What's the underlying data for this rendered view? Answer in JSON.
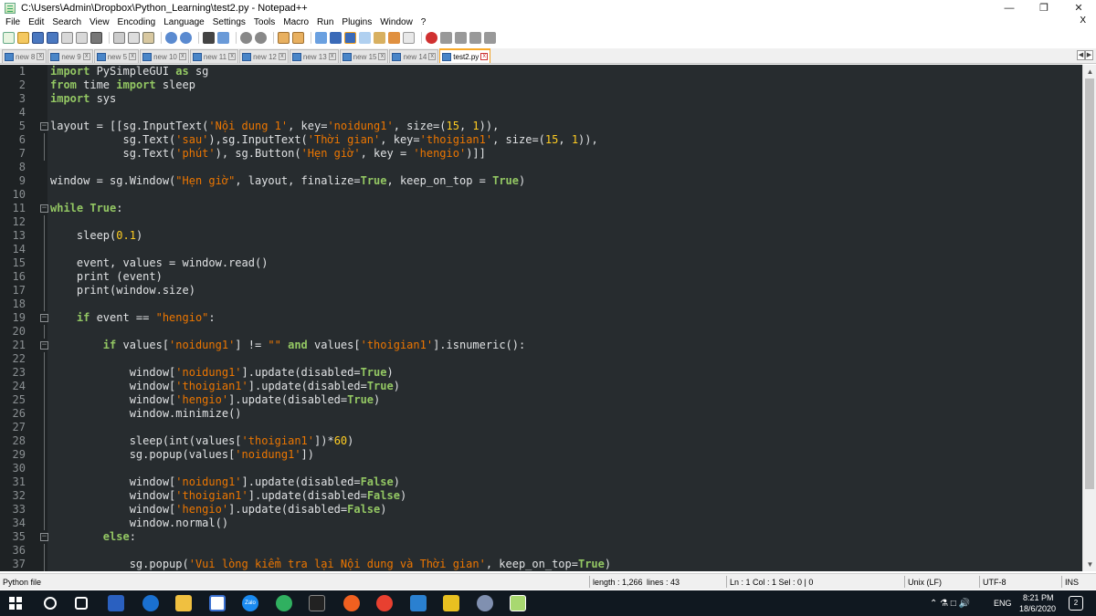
{
  "window": {
    "title": "C:\\Users\\Admin\\Dropbox\\Python_Learning\\test2.py - Notepad++",
    "minimize": "—",
    "restore": "❐",
    "close": "✕"
  },
  "menu": {
    "items": [
      "File",
      "Edit",
      "Search",
      "View",
      "Encoding",
      "Language",
      "Settings",
      "Tools",
      "Macro",
      "Run",
      "Plugins",
      "Window",
      "?"
    ],
    "close": "X"
  },
  "tabs": [
    {
      "label": "new 8"
    },
    {
      "label": "new 9"
    },
    {
      "label": "new 5"
    },
    {
      "label": "new 10"
    },
    {
      "label": "new 11"
    },
    {
      "label": "new 12"
    },
    {
      "label": "new 13"
    },
    {
      "label": "new 15"
    },
    {
      "label": "new 14"
    },
    {
      "label": "test2.py",
      "active": true
    }
  ],
  "editor": {
    "lines": [
      {
        "n": "1",
        "code": [
          [
            "kw",
            "import"
          ],
          [
            "p",
            " PySimpleGUI "
          ],
          [
            "kw",
            "as"
          ],
          [
            "p",
            " sg"
          ]
        ]
      },
      {
        "n": "2",
        "code": [
          [
            "kw",
            "from"
          ],
          [
            "p",
            " time "
          ],
          [
            "kw",
            "import"
          ],
          [
            "p",
            " sleep"
          ]
        ]
      },
      {
        "n": "3",
        "code": [
          [
            "kw",
            "import"
          ],
          [
            "p",
            " sys"
          ]
        ]
      },
      {
        "n": "4",
        "code": []
      },
      {
        "n": "5",
        "fold": "box",
        "code": [
          [
            "p",
            "layout = [[sg.InputText("
          ],
          [
            "str",
            "'Nội dung 1'"
          ],
          [
            "p",
            ", key="
          ],
          [
            "str",
            "'noidung1'"
          ],
          [
            "p",
            ", size=("
          ],
          [
            "num",
            "15"
          ],
          [
            "p",
            ", "
          ],
          [
            "num",
            "1"
          ],
          [
            "p",
            ")),"
          ]
        ]
      },
      {
        "n": "6",
        "fold": "line",
        "code": [
          [
            "p",
            "           sg.Text("
          ],
          [
            "str",
            "'sau'"
          ],
          [
            "p",
            "),sg.InputText("
          ],
          [
            "str",
            "'Thời gian'"
          ],
          [
            "p",
            ", key="
          ],
          [
            "str",
            "'thoigian1'"
          ],
          [
            "p",
            ", size=("
          ],
          [
            "num",
            "15"
          ],
          [
            "p",
            ", "
          ],
          [
            "num",
            "1"
          ],
          [
            "p",
            ")),"
          ]
        ]
      },
      {
        "n": "7",
        "fold": "line",
        "code": [
          [
            "p",
            "           sg.Text("
          ],
          [
            "str",
            "'phút'"
          ],
          [
            "p",
            "), sg.Button("
          ],
          [
            "str",
            "'Hẹn giờ'"
          ],
          [
            "p",
            ", key = "
          ],
          [
            "str",
            "'hengio'"
          ],
          [
            "p",
            ")]]"
          ]
        ]
      },
      {
        "n": "8",
        "code": []
      },
      {
        "n": "9",
        "code": [
          [
            "p",
            "window = sg.Window("
          ],
          [
            "str",
            "\"Hẹn giờ\""
          ],
          [
            "p",
            ", layout, finalize="
          ],
          [
            "kw",
            "True"
          ],
          [
            "p",
            ", keep_on_top = "
          ],
          [
            "kw",
            "True"
          ],
          [
            "p",
            ")"
          ]
        ]
      },
      {
        "n": "10",
        "code": []
      },
      {
        "n": "11",
        "fold": "box",
        "code": [
          [
            "kw",
            "while"
          ],
          [
            "p",
            " "
          ],
          [
            "kw",
            "True"
          ],
          [
            "p",
            ":"
          ]
        ]
      },
      {
        "n": "12",
        "fold": "line",
        "code": []
      },
      {
        "n": "13",
        "fold": "line",
        "code": [
          [
            "p",
            "    sleep("
          ],
          [
            "num",
            "0.1"
          ],
          [
            "p",
            ")"
          ]
        ]
      },
      {
        "n": "14",
        "fold": "line",
        "code": []
      },
      {
        "n": "15",
        "fold": "line",
        "code": [
          [
            "p",
            "    event, values = window.read()"
          ]
        ]
      },
      {
        "n": "16",
        "fold": "line",
        "code": [
          [
            "p",
            "    print (event)"
          ]
        ]
      },
      {
        "n": "17",
        "fold": "line",
        "code": [
          [
            "p",
            "    print(window.size)"
          ]
        ]
      },
      {
        "n": "18",
        "fold": "line",
        "code": []
      },
      {
        "n": "19",
        "fold": "box",
        "code": [
          [
            "p",
            "    "
          ],
          [
            "kw",
            "if"
          ],
          [
            "p",
            " event == "
          ],
          [
            "str",
            "\"hengio\""
          ],
          [
            "p",
            ":"
          ]
        ]
      },
      {
        "n": "20",
        "fold": "line",
        "code": []
      },
      {
        "n": "21",
        "fold": "box",
        "code": [
          [
            "p",
            "        "
          ],
          [
            "kw",
            "if"
          ],
          [
            "p",
            " values["
          ],
          [
            "str",
            "'noidung1'"
          ],
          [
            "p",
            "] != "
          ],
          [
            "str",
            "\"\""
          ],
          [
            "p",
            " "
          ],
          [
            "kw",
            "and"
          ],
          [
            "p",
            " values["
          ],
          [
            "str",
            "'thoigian1'"
          ],
          [
            "p",
            "].isnumeric():"
          ]
        ]
      },
      {
        "n": "22",
        "fold": "line",
        "code": []
      },
      {
        "n": "23",
        "fold": "line",
        "code": [
          [
            "p",
            "            window["
          ],
          [
            "str",
            "'noidung1'"
          ],
          [
            "p",
            "].update(disabled="
          ],
          [
            "kw",
            "True"
          ],
          [
            "p",
            ")"
          ]
        ]
      },
      {
        "n": "24",
        "fold": "line",
        "code": [
          [
            "p",
            "            window["
          ],
          [
            "str",
            "'thoigian1'"
          ],
          [
            "p",
            "].update(disabled="
          ],
          [
            "kw",
            "True"
          ],
          [
            "p",
            ")"
          ]
        ]
      },
      {
        "n": "25",
        "fold": "line",
        "code": [
          [
            "p",
            "            window["
          ],
          [
            "str",
            "'hengio'"
          ],
          [
            "p",
            "].update(disabled="
          ],
          [
            "kw",
            "True"
          ],
          [
            "p",
            ")"
          ]
        ]
      },
      {
        "n": "26",
        "fold": "line",
        "code": [
          [
            "p",
            "            window.minimize()"
          ]
        ]
      },
      {
        "n": "27",
        "fold": "line",
        "code": []
      },
      {
        "n": "28",
        "fold": "line",
        "code": [
          [
            "p",
            "            sleep(int(values["
          ],
          [
            "str",
            "'thoigian1'"
          ],
          [
            "p",
            "])*"
          ],
          [
            "num",
            "60"
          ],
          [
            "p",
            ")"
          ]
        ]
      },
      {
        "n": "29",
        "fold": "line",
        "code": [
          [
            "p",
            "            sg.popup(values["
          ],
          [
            "str",
            "'noidung1'"
          ],
          [
            "p",
            "])"
          ]
        ]
      },
      {
        "n": "30",
        "fold": "line",
        "code": []
      },
      {
        "n": "31",
        "fold": "line",
        "code": [
          [
            "p",
            "            window["
          ],
          [
            "str",
            "'noidung1'"
          ],
          [
            "p",
            "].update(disabled="
          ],
          [
            "kw",
            "False"
          ],
          [
            "p",
            ")"
          ]
        ]
      },
      {
        "n": "32",
        "fold": "line",
        "code": [
          [
            "p",
            "            window["
          ],
          [
            "str",
            "'thoigian1'"
          ],
          [
            "p",
            "].update(disabled="
          ],
          [
            "kw",
            "False"
          ],
          [
            "p",
            ")"
          ]
        ]
      },
      {
        "n": "33",
        "fold": "line",
        "code": [
          [
            "p",
            "            window["
          ],
          [
            "str",
            "'hengio'"
          ],
          [
            "p",
            "].update(disabled="
          ],
          [
            "kw",
            "False"
          ],
          [
            "p",
            ")"
          ]
        ]
      },
      {
        "n": "34",
        "fold": "line",
        "code": [
          [
            "p",
            "            window.normal()"
          ]
        ]
      },
      {
        "n": "35",
        "fold": "box",
        "code": [
          [
            "p",
            "        "
          ],
          [
            "kw",
            "else"
          ],
          [
            "p",
            ":"
          ]
        ]
      },
      {
        "n": "36",
        "fold": "line",
        "code": []
      },
      {
        "n": "37",
        "fold": "line",
        "code": [
          [
            "p",
            "            sg.popup("
          ],
          [
            "str",
            "'Vui lòng kiểm tra lại Nội dung và Thời gian'"
          ],
          [
            "p",
            ", keep_on_top="
          ],
          [
            "kw",
            "True"
          ],
          [
            "p",
            ")"
          ]
        ]
      }
    ]
  },
  "status": {
    "file_type": "Python file",
    "length": "length : 1,266",
    "lines": "lines : 43",
    "position": "Ln : 1    Col : 1    Sel : 0 | 0",
    "eol": "Unix (LF)",
    "encoding": "UTF-8",
    "mode": "INS"
  },
  "taskbar": {
    "lang": "ENG",
    "time": "8:21 PM",
    "date": "18/6/2020",
    "notifications": "2",
    "zalo": "Zalo"
  },
  "colors": {
    "editor_bg": "#272c2f",
    "keyword": "#93c763",
    "string": "#ec7600",
    "number": "#ffcd22"
  }
}
